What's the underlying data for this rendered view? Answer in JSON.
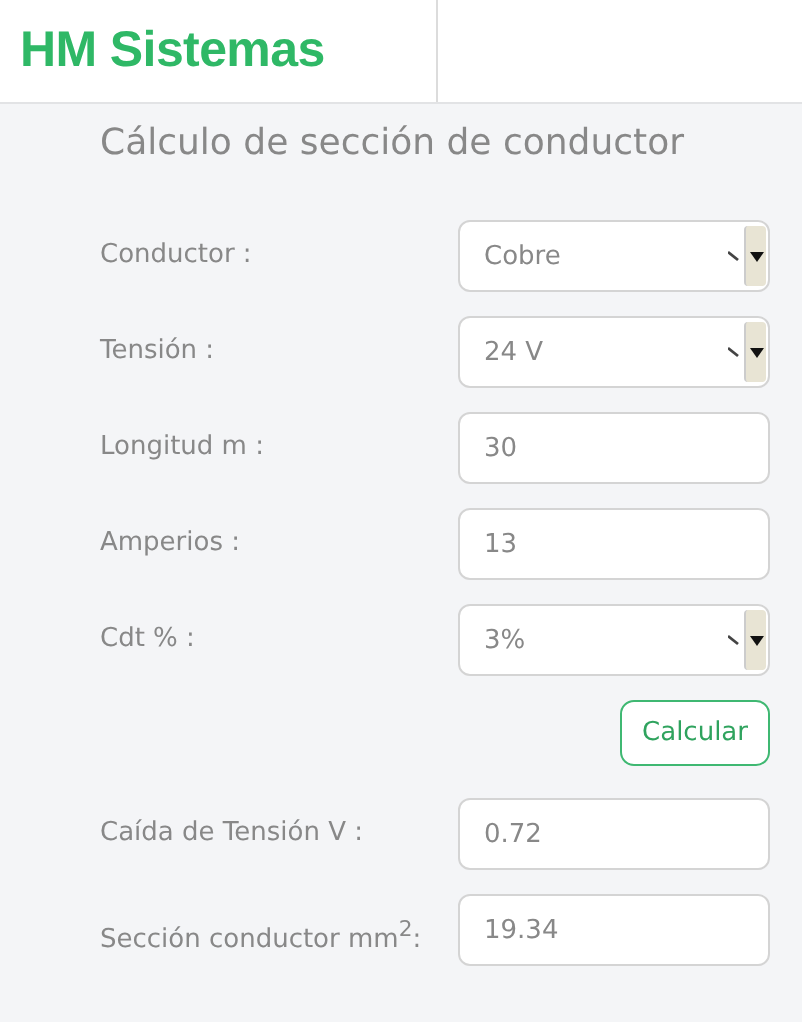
{
  "header": {
    "brand": "HM Sistemas"
  },
  "form": {
    "title": "Cálculo de sección de conductor",
    "fields": [
      {
        "label": "Conductor :",
        "kind": "select",
        "value": "Cobre"
      },
      {
        "label": "Tensión :",
        "kind": "select",
        "value": "24 V"
      },
      {
        "label": "Longitud m :",
        "kind": "input",
        "value": "30"
      },
      {
        "label": "Amperios :",
        "kind": "input",
        "value": "13"
      },
      {
        "label": "Cdt % :",
        "kind": "select",
        "value": "3%"
      }
    ],
    "button": "Calcular",
    "results": [
      {
        "label": "Caída de Tensión V :",
        "kind": "input",
        "value": "0.72"
      },
      {
        "label": "Sección conductor mm$^{2}$:",
        "kind": "input",
        "value": "19.34"
      }
    ]
  }
}
